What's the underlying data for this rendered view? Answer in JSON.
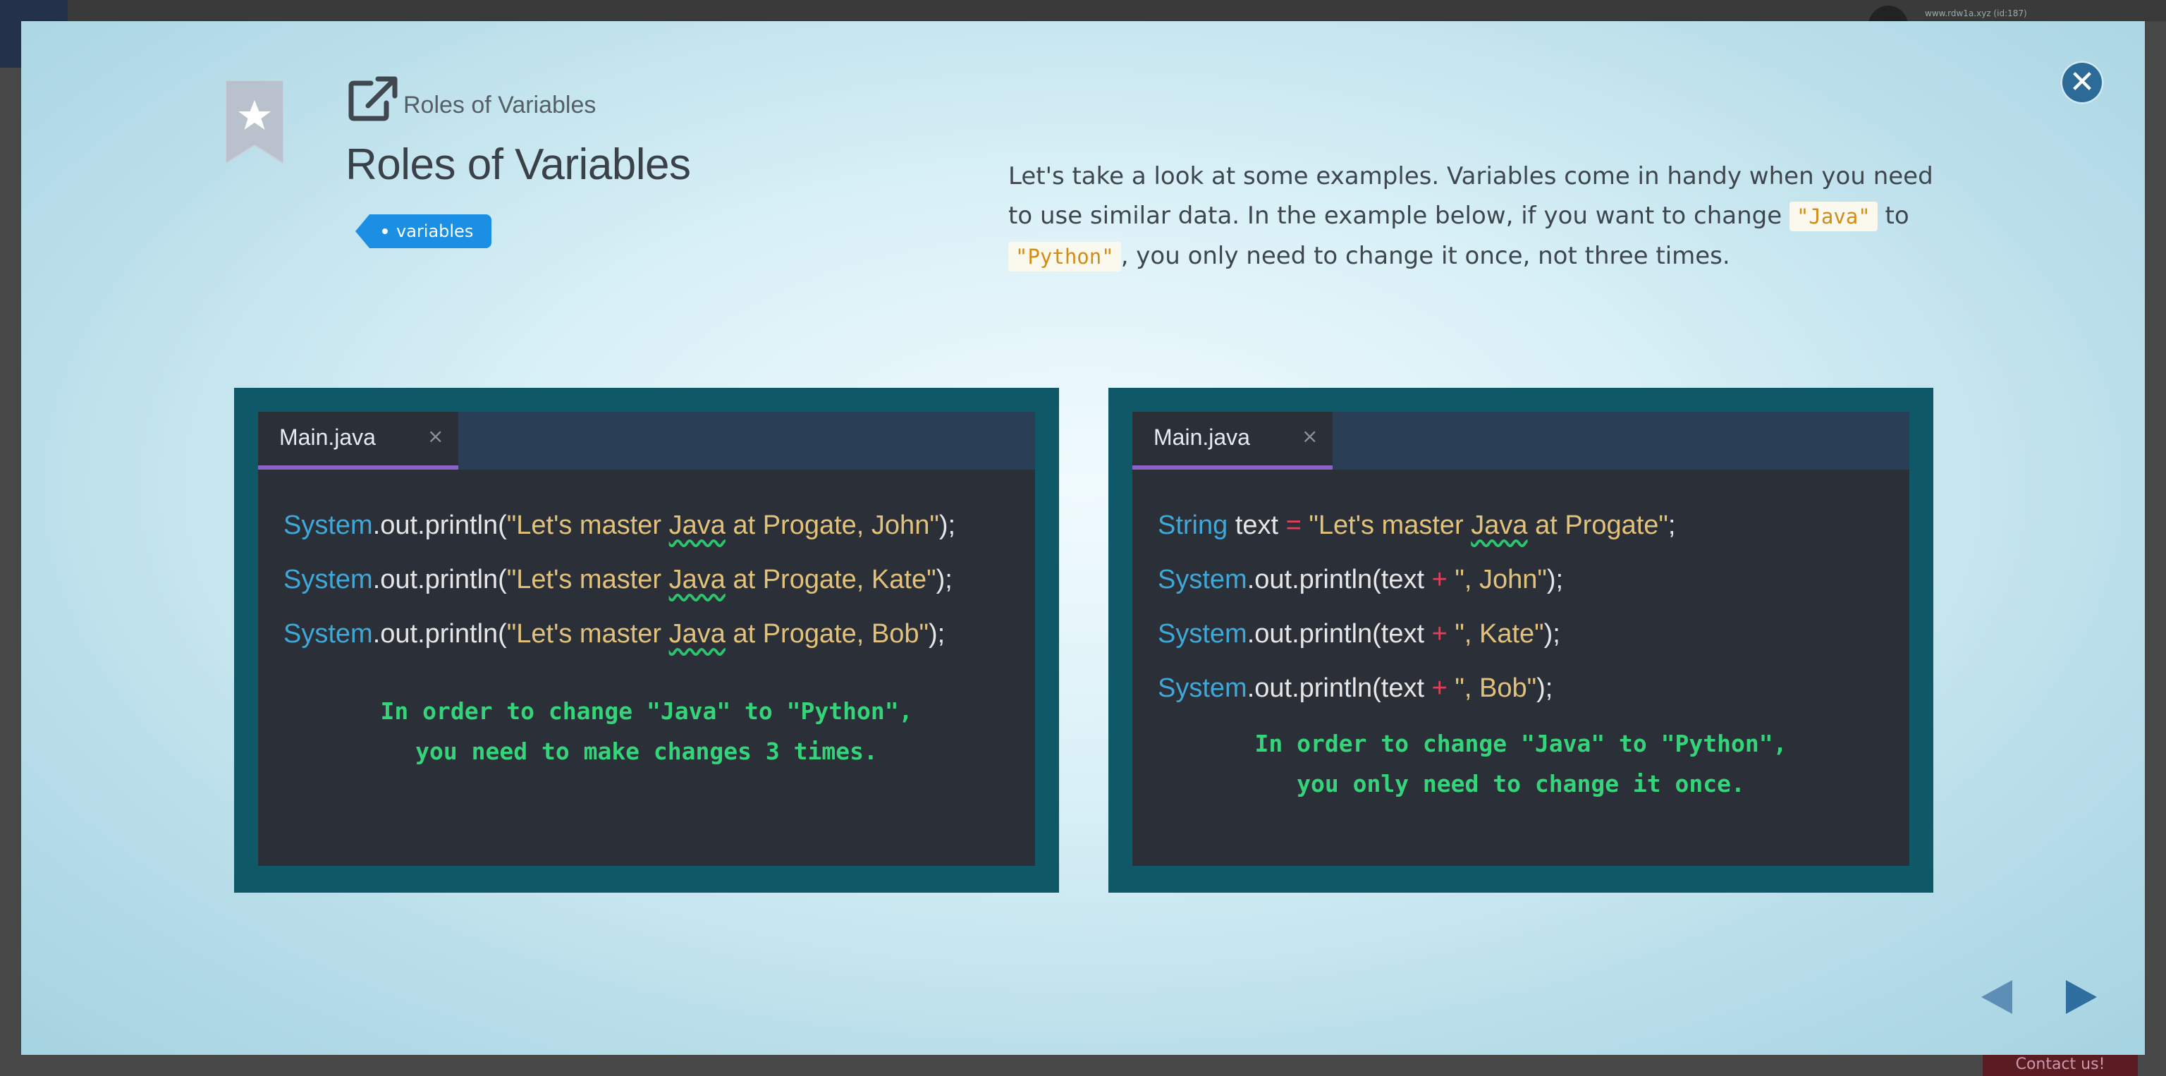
{
  "background": {
    "url_text": "www.rdw1a.xyz (id:187)",
    "contact_label": "Contact us!"
  },
  "header": {
    "breadcrumb": "Roles of Variables",
    "title": "Roles of Variables",
    "tag": "variables",
    "close_icon": "close-icon",
    "bookmark_icon": "bookmark-star-icon",
    "link_icon": "external-link-icon"
  },
  "description": {
    "part1": "Let's take a look at some examples. Variables come in handy when you need to use similar data. In the example below, if you want to change ",
    "code1": "\"Java\"",
    "part2": " to ",
    "code2": "\"Python\"",
    "part3": ", you only need to change it once, not three times."
  },
  "left_editor": {
    "tab_label": "Main.java",
    "tab_close": "×",
    "lines": [
      {
        "obj": "System",
        "call": ".out.println(",
        "str_a": "\"Let's master ",
        "str_java": "Java",
        "str_b": " at Progate, John\"",
        "end": ");"
      },
      {
        "obj": "System",
        "call": ".out.println(",
        "str_a": "\"Let's master ",
        "str_java": "Java",
        "str_b": " at Progate, Kate\"",
        "end": ");"
      },
      {
        "obj": "System",
        "call": ".out.println(",
        "str_a": "\"Let's master ",
        "str_java": "Java",
        "str_b": " at Progate, Bob\"",
        "end": ");"
      }
    ],
    "note_line1": "In order to change \"Java\" to \"Python\",",
    "note_line2": "you need to make changes 3 times."
  },
  "right_editor": {
    "tab_label": "Main.java",
    "tab_close": "×",
    "decl": {
      "type": "String",
      "name": " text ",
      "eq": "=",
      "str_a": " \"Let's master ",
      "str_java": "Java",
      "str_b": " at Progate\"",
      "end": ";"
    },
    "lines": [
      {
        "obj": "System",
        "call": ".out.println(text ",
        "plus": "+",
        "str": " \", John\"",
        "end": ");"
      },
      {
        "obj": "System",
        "call": ".out.println(text ",
        "plus": "+",
        "str": " \", Kate\"",
        "end": ");"
      },
      {
        "obj": "System",
        "call": ".out.println(text ",
        "plus": "+",
        "str": " \", Bob\"",
        "end": ");"
      }
    ],
    "note_line1": "In order to change \"Java\" to \"Python\",",
    "note_line2": "you only need to change it once."
  },
  "navigation": {
    "prev_icon": "triangle-left-icon",
    "next_icon": "triangle-right-icon"
  },
  "colors": {
    "accent": "#1a8fe3",
    "close": "#2c6a98",
    "panel": "#0f5868",
    "editor": "#2b2f37",
    "keyword": "#3ea8d8",
    "string": "#e2c27a",
    "note": "#36d47a"
  }
}
